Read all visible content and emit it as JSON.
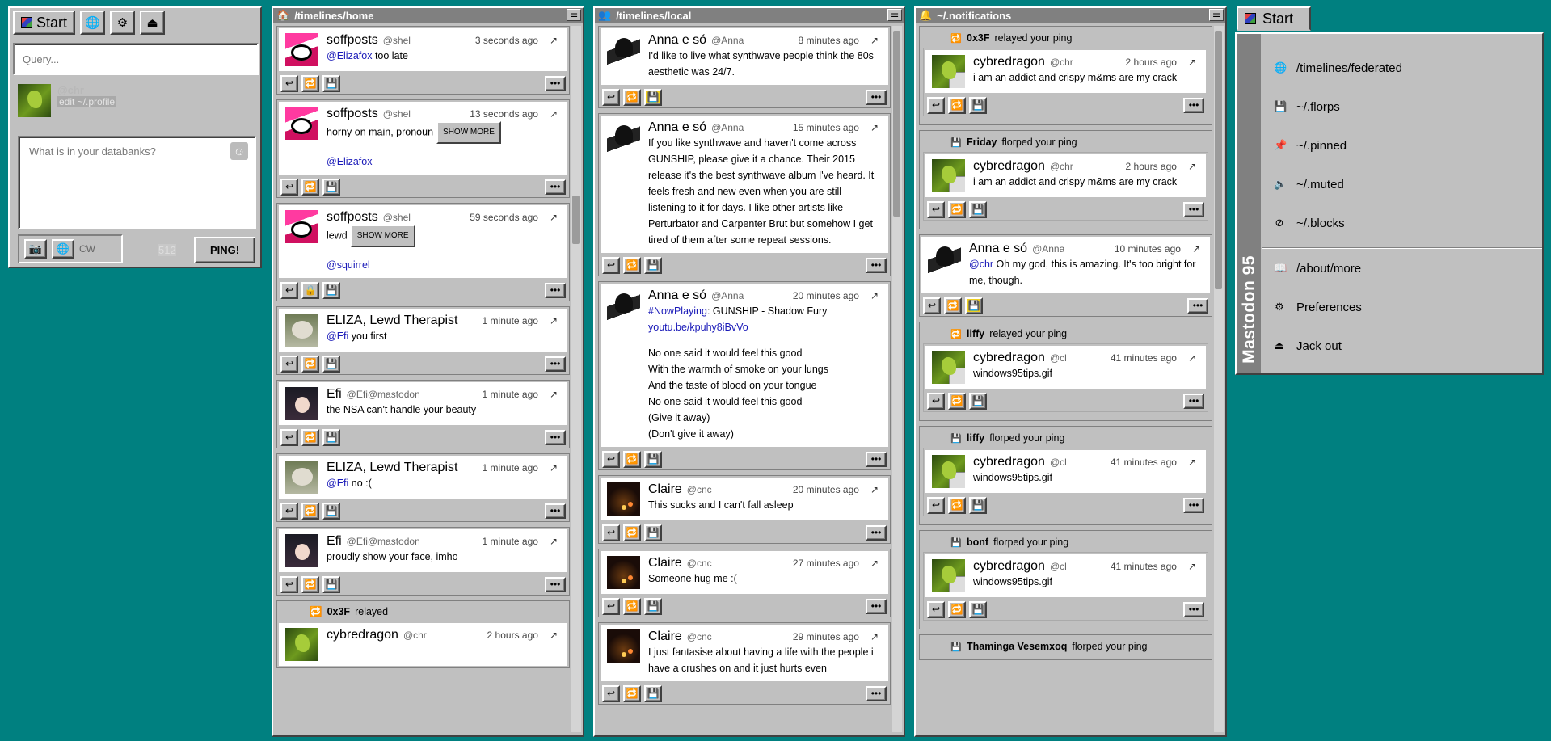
{
  "compose": {
    "start_label": "Start",
    "query_placeholder": "Query...",
    "user_handle": "@chr",
    "edit_profile": "edit ~/.profile",
    "toot_placeholder": "What is in your databanks?",
    "cw_label": "CW",
    "char_count": "512",
    "ping_label": "PING!"
  },
  "columns": {
    "home": {
      "title": "/timelines/home"
    },
    "local": {
      "title": "/timelines/local"
    },
    "notifications": {
      "title": "~/.notifications"
    }
  },
  "home_posts": [
    {
      "name": "soffposts",
      "handle": "@shel",
      "time": "3 seconds ago",
      "mention": "@Elizafox",
      "text": " too late"
    },
    {
      "name": "soffposts",
      "handle": "@shel",
      "time": "13 seconds ago",
      "text": "horny on main, pronoun",
      "showmore": "SHOW MORE",
      "mention2": "@Elizafox"
    },
    {
      "name": "soffposts",
      "handle": "@shel",
      "time": "59 seconds ago",
      "text": "lewd",
      "showmore": "SHOW MORE",
      "mention2": "@squirrel"
    },
    {
      "name": "ELIZA, Lewd Therapist",
      "handle": "",
      "time": "1 minute ago",
      "mention": "@Efi",
      "text": " you first"
    },
    {
      "name": "Efi",
      "handle": "@Efi@mastodon.soc",
      "time": "1 minute ago",
      "text": "the NSA can't handle your beauty"
    },
    {
      "name": "ELIZA, Lewd Therapist",
      "handle": "",
      "time": "1 minute ago",
      "mention": "@Efi",
      "text": " no :("
    },
    {
      "name": "Efi",
      "handle": "@Efi@mastodon.soc",
      "time": "1 minute ago",
      "text": "proudly show your face, imho"
    }
  ],
  "home_boost": {
    "who": "0x3F",
    "action": "relayed",
    "name": "cybredragon",
    "handle": "@chr",
    "time": "2 hours ago"
  },
  "local_posts": [
    {
      "name": "Anna e só",
      "handle": "@Anna",
      "time": "8 minutes ago",
      "text": "I'd like to live what synthwave people think the 80s aesthetic was 24/7."
    },
    {
      "name": "Anna e só",
      "handle": "@Anna",
      "time": "15 minutes ago",
      "text": "If you like synthwave and haven't come across GUNSHIP, please give it a chance. Their 2015 release it's the best synthwave album I've heard. It feels fresh and new even when you are still listening to it for days. I like other artists like Perturbator and Carpenter Brut but somehow I get tired of them after some repeat sessions."
    },
    {
      "name": "Anna e só",
      "handle": "@Anna",
      "time": "20 minutes ago",
      "hashtag": "#NowPlaying",
      "text": ": GUNSHIP - Shadow Fury",
      "link": "youtu.be/kpuhy8iBvVo",
      "lyrics": [
        "No one said it would feel this good",
        "With the warmth of smoke on your lungs",
        "And the taste of blood on your tongue",
        "No one said it would feel this good",
        "(Give it away)",
        "(Don't give it away)"
      ]
    },
    {
      "name": "Claire",
      "handle": "@cnc",
      "time": "20 minutes ago",
      "text": "This sucks and I can't fall asleep"
    },
    {
      "name": "Claire",
      "handle": "@cnc",
      "time": "27 minutes ago",
      "text": "Someone hug me :("
    },
    {
      "name": "Claire",
      "handle": "@cnc",
      "time": "29 minutes ago",
      "text": "I just fantasise about having a life with the people i have a crushes on and it just hurts even"
    }
  ],
  "notifications": [
    {
      "who": "0x3F",
      "action": "relayed your ping",
      "name": "cybredragon",
      "handle": "@chr",
      "time": "2 hours ago",
      "text": "i am an addict and crispy m&ms are my crack"
    },
    {
      "who": "Friday",
      "action": "florped your ping",
      "name": "cybredragon",
      "handle": "@chr",
      "time": "2 hours ago",
      "text": "i am an addict and crispy m&ms are my crack"
    },
    {
      "who": "liffy",
      "action": "relayed your ping",
      "name": "cybredragon",
      "handle": "@cl",
      "time": "41 minutes ago",
      "text": "windows95tips.gif"
    },
    {
      "who": "liffy",
      "action": "florped your ping",
      "name": "cybredragon",
      "handle": "@cl",
      "time": "41 minutes ago",
      "text": "windows95tips.gif"
    },
    {
      "who": "bonf",
      "action": "florped your ping",
      "name": "cybredragon",
      "handle": "@cl",
      "time": "41 minutes ago",
      "text": "windows95tips.gif"
    }
  ],
  "notif_mention": {
    "name": "Anna e só",
    "handle": "@Anna",
    "time": "10 minutes ago",
    "mention": "@chr",
    "text": " Oh my god, this is amazing. It's too bright for me, though."
  },
  "notif_last": {
    "who": "Thaminga Vesemxoq",
    "action": "florped your ping"
  },
  "start_menu": {
    "tab_label": "Start",
    "brand": "Mastodon 95",
    "items": [
      "/timelines/federated",
      "~/.florps",
      "~/.pinned",
      "~/.muted",
      "~/.blocks",
      "/about/more",
      "Preferences",
      "Jack out"
    ]
  }
}
